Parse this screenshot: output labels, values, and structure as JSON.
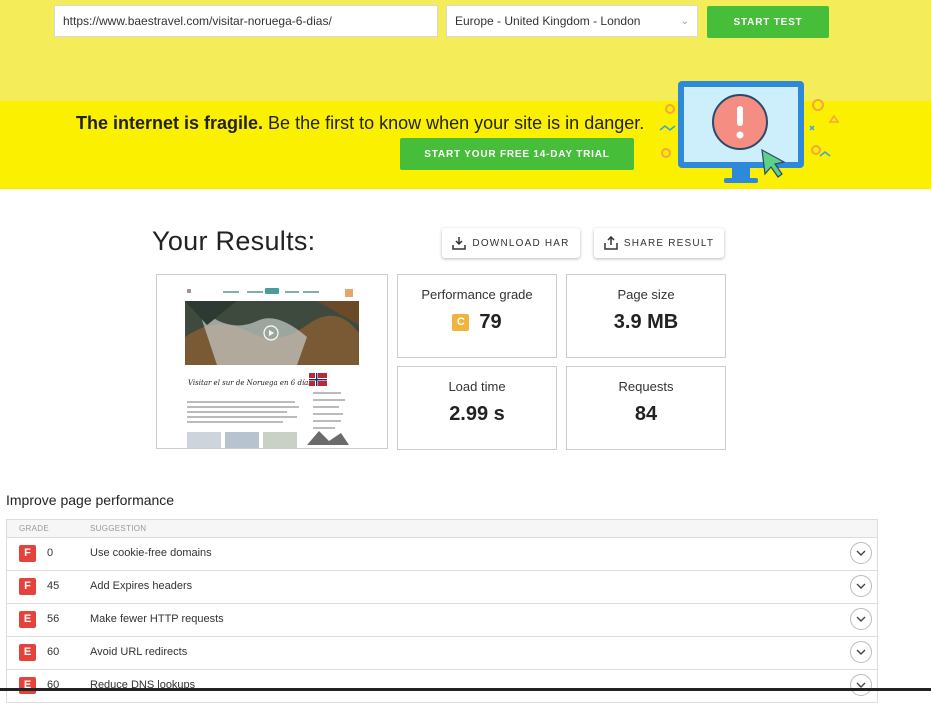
{
  "search": {
    "url_value": "https://www.baestravel.com/visitar-noruega-6-dias/",
    "location_selected": "Europe - United Kingdom - London",
    "start_label": "START TEST"
  },
  "promo": {
    "bold": "The internet is fragile.",
    "text": " Be the first to know when your site is in danger.",
    "trial_label": "START YOUR FREE 14-DAY TRIAL"
  },
  "results": {
    "title": "Your Results:",
    "download_label": "DOWNLOAD HAR",
    "share_label": "SHARE RESULT"
  },
  "metrics": {
    "grade_label": "Performance grade",
    "grade_letter": "C",
    "grade_value": "79",
    "size_label": "Page size",
    "size_value": "3.9 MB",
    "load_label": "Load time",
    "load_value": "2.99 s",
    "requests_label": "Requests",
    "requests_value": "84"
  },
  "preview": {
    "headline": "Visitar el sur de Noruega en 6 días"
  },
  "improve": {
    "heading": "Improve page performance",
    "col_grade": "GRADE",
    "col_suggestion": "SUGGESTION",
    "rows": [
      {
        "grade": "F",
        "score": "0",
        "suggestion": "Use cookie-free domains"
      },
      {
        "grade": "F",
        "score": "45",
        "suggestion": "Add Expires headers"
      },
      {
        "grade": "E",
        "score": "56",
        "suggestion": "Make fewer HTTP requests"
      },
      {
        "grade": "E",
        "score": "60",
        "suggestion": "Avoid URL redirects"
      },
      {
        "grade": "E",
        "score": "60",
        "suggestion": "Reduce DNS lookups"
      }
    ]
  },
  "colors": {
    "accent_green": "#46be3a",
    "band_yellow": "#fbf000",
    "grade_c": "#f0b33c",
    "grade_fail": "#e6423c"
  },
  "icons": {
    "download": "download-icon",
    "share": "share-icon",
    "expand": "chevron-down-icon"
  }
}
